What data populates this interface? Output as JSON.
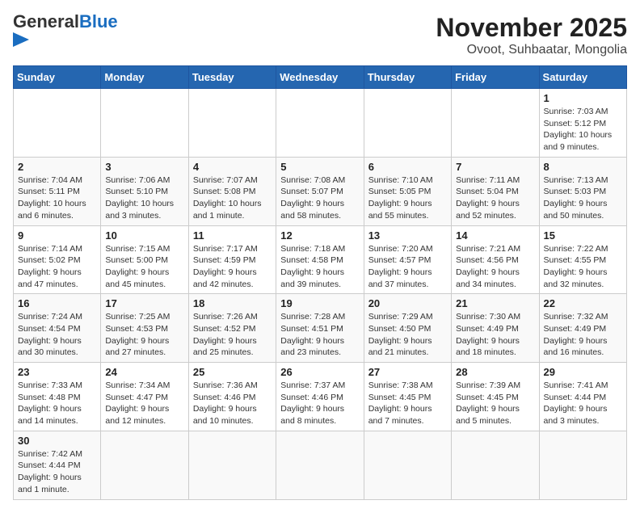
{
  "logo": {
    "text_general": "General",
    "text_blue": "Blue"
  },
  "title": "November 2025",
  "subtitle": "Ovoot, Suhbaatar, Mongolia",
  "days_of_week": [
    "Sunday",
    "Monday",
    "Tuesday",
    "Wednesday",
    "Thursday",
    "Friday",
    "Saturday"
  ],
  "weeks": [
    [
      {
        "day": "",
        "info": ""
      },
      {
        "day": "",
        "info": ""
      },
      {
        "day": "",
        "info": ""
      },
      {
        "day": "",
        "info": ""
      },
      {
        "day": "",
        "info": ""
      },
      {
        "day": "",
        "info": ""
      },
      {
        "day": "1",
        "info": "Sunrise: 7:03 AM\nSunset: 5:12 PM\nDaylight: 10 hours and 9 minutes."
      }
    ],
    [
      {
        "day": "2",
        "info": "Sunrise: 7:04 AM\nSunset: 5:11 PM\nDaylight: 10 hours and 6 minutes."
      },
      {
        "day": "3",
        "info": "Sunrise: 7:06 AM\nSunset: 5:10 PM\nDaylight: 10 hours and 3 minutes."
      },
      {
        "day": "4",
        "info": "Sunrise: 7:07 AM\nSunset: 5:08 PM\nDaylight: 10 hours and 1 minute."
      },
      {
        "day": "5",
        "info": "Sunrise: 7:08 AM\nSunset: 5:07 PM\nDaylight: 9 hours and 58 minutes."
      },
      {
        "day": "6",
        "info": "Sunrise: 7:10 AM\nSunset: 5:05 PM\nDaylight: 9 hours and 55 minutes."
      },
      {
        "day": "7",
        "info": "Sunrise: 7:11 AM\nSunset: 5:04 PM\nDaylight: 9 hours and 52 minutes."
      },
      {
        "day": "8",
        "info": "Sunrise: 7:13 AM\nSunset: 5:03 PM\nDaylight: 9 hours and 50 minutes."
      }
    ],
    [
      {
        "day": "9",
        "info": "Sunrise: 7:14 AM\nSunset: 5:02 PM\nDaylight: 9 hours and 47 minutes."
      },
      {
        "day": "10",
        "info": "Sunrise: 7:15 AM\nSunset: 5:00 PM\nDaylight: 9 hours and 45 minutes."
      },
      {
        "day": "11",
        "info": "Sunrise: 7:17 AM\nSunset: 4:59 PM\nDaylight: 9 hours and 42 minutes."
      },
      {
        "day": "12",
        "info": "Sunrise: 7:18 AM\nSunset: 4:58 PM\nDaylight: 9 hours and 39 minutes."
      },
      {
        "day": "13",
        "info": "Sunrise: 7:20 AM\nSunset: 4:57 PM\nDaylight: 9 hours and 37 minutes."
      },
      {
        "day": "14",
        "info": "Sunrise: 7:21 AM\nSunset: 4:56 PM\nDaylight: 9 hours and 34 minutes."
      },
      {
        "day": "15",
        "info": "Sunrise: 7:22 AM\nSunset: 4:55 PM\nDaylight: 9 hours and 32 minutes."
      }
    ],
    [
      {
        "day": "16",
        "info": "Sunrise: 7:24 AM\nSunset: 4:54 PM\nDaylight: 9 hours and 30 minutes."
      },
      {
        "day": "17",
        "info": "Sunrise: 7:25 AM\nSunset: 4:53 PM\nDaylight: 9 hours and 27 minutes."
      },
      {
        "day": "18",
        "info": "Sunrise: 7:26 AM\nSunset: 4:52 PM\nDaylight: 9 hours and 25 minutes."
      },
      {
        "day": "19",
        "info": "Sunrise: 7:28 AM\nSunset: 4:51 PM\nDaylight: 9 hours and 23 minutes."
      },
      {
        "day": "20",
        "info": "Sunrise: 7:29 AM\nSunset: 4:50 PM\nDaylight: 9 hours and 21 minutes."
      },
      {
        "day": "21",
        "info": "Sunrise: 7:30 AM\nSunset: 4:49 PM\nDaylight: 9 hours and 18 minutes."
      },
      {
        "day": "22",
        "info": "Sunrise: 7:32 AM\nSunset: 4:49 PM\nDaylight: 9 hours and 16 minutes."
      }
    ],
    [
      {
        "day": "23",
        "info": "Sunrise: 7:33 AM\nSunset: 4:48 PM\nDaylight: 9 hours and 14 minutes."
      },
      {
        "day": "24",
        "info": "Sunrise: 7:34 AM\nSunset: 4:47 PM\nDaylight: 9 hours and 12 minutes."
      },
      {
        "day": "25",
        "info": "Sunrise: 7:36 AM\nSunset: 4:46 PM\nDaylight: 9 hours and 10 minutes."
      },
      {
        "day": "26",
        "info": "Sunrise: 7:37 AM\nSunset: 4:46 PM\nDaylight: 9 hours and 8 minutes."
      },
      {
        "day": "27",
        "info": "Sunrise: 7:38 AM\nSunset: 4:45 PM\nDaylight: 9 hours and 7 minutes."
      },
      {
        "day": "28",
        "info": "Sunrise: 7:39 AM\nSunset: 4:45 PM\nDaylight: 9 hours and 5 minutes."
      },
      {
        "day": "29",
        "info": "Sunrise: 7:41 AM\nSunset: 4:44 PM\nDaylight: 9 hours and 3 minutes."
      }
    ],
    [
      {
        "day": "30",
        "info": "Sunrise: 7:42 AM\nSunset: 4:44 PM\nDaylight: 9 hours and 1 minute."
      },
      {
        "day": "",
        "info": ""
      },
      {
        "day": "",
        "info": ""
      },
      {
        "day": "",
        "info": ""
      },
      {
        "day": "",
        "info": ""
      },
      {
        "day": "",
        "info": ""
      },
      {
        "day": "",
        "info": ""
      }
    ]
  ]
}
